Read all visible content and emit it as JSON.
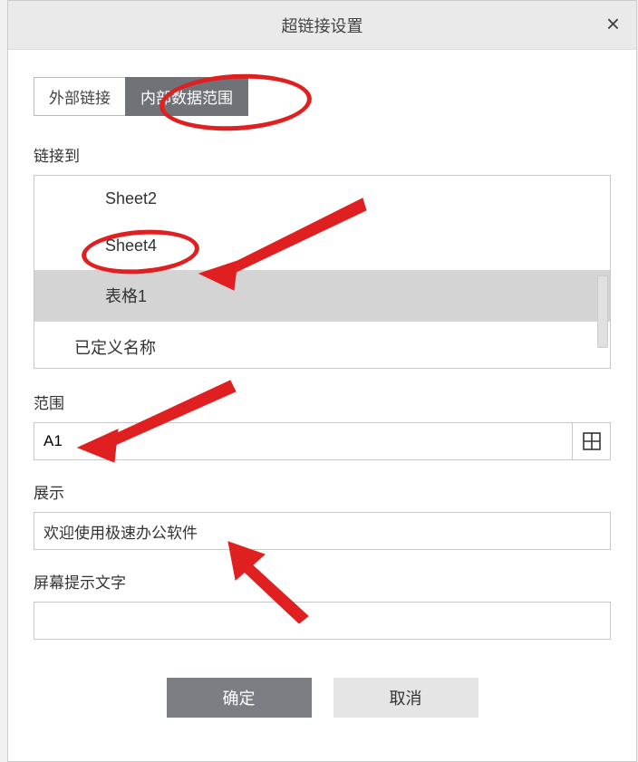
{
  "dialog": {
    "title": "超链接设置"
  },
  "tabs": {
    "external": "外部链接",
    "internal": "内部数据范围"
  },
  "link_to": {
    "label": "链接到",
    "items": [
      {
        "label": "Sheet2",
        "level": 1,
        "selected": false
      },
      {
        "label": "Sheet4",
        "level": 1,
        "selected": false
      },
      {
        "label": "表格1",
        "level": 1,
        "selected": true
      },
      {
        "label": "已定义名称",
        "level": 0,
        "selected": false
      }
    ]
  },
  "range": {
    "label": "范围",
    "value": "A1"
  },
  "display": {
    "label": "展示",
    "value": "欢迎使用极速办公软件"
  },
  "tooltip": {
    "label": "屏幕提示文字",
    "value": ""
  },
  "buttons": {
    "ok": "确定",
    "cancel": "取消"
  }
}
